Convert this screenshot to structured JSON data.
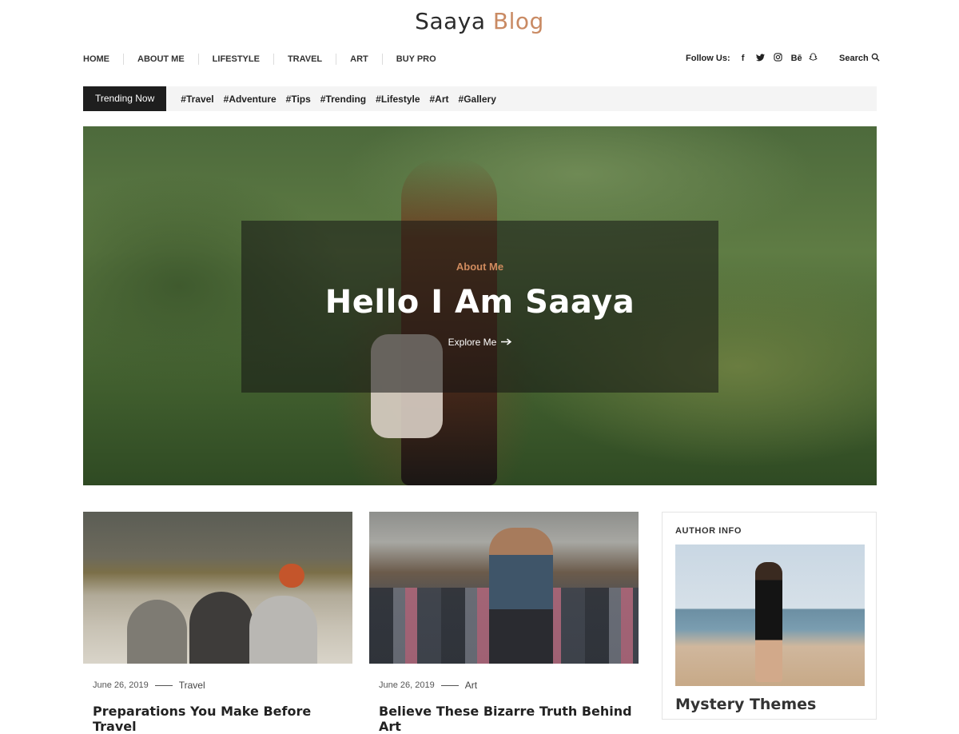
{
  "site": {
    "brand_part1": "Saaya",
    "brand_part2": "Blog",
    "accent_color": "#c98a63"
  },
  "nav": {
    "items": [
      "HOME",
      "ABOUT ME",
      "LIFESTYLE",
      "TRAVEL",
      "ART",
      "BUY PRO"
    ]
  },
  "follow": {
    "label": "Follow Us:",
    "icons": [
      {
        "name": "facebook-icon",
        "glyph": "f"
      },
      {
        "name": "twitter-icon",
        "glyph": "🐦"
      },
      {
        "name": "instagram-icon",
        "glyph": "◎"
      },
      {
        "name": "behance-icon",
        "glyph": "Bē"
      },
      {
        "name": "snapchat-icon",
        "glyph": "👻"
      }
    ]
  },
  "search": {
    "label": "Search",
    "icon": "search-icon"
  },
  "trending": {
    "label": "Trending Now",
    "tags": [
      "#Travel",
      "#Adventure",
      "#Tips",
      "#Trending",
      "#Lifestyle",
      "#Art",
      "#Gallery"
    ]
  },
  "hero": {
    "category": "About Me",
    "title": "Hello I Am Saaya",
    "cta": "Explore Me",
    "cta_icon": "arrow-right-icon"
  },
  "posts": [
    {
      "date": "June 26, 2019",
      "category": "Travel",
      "title": "Preparations You Make Before Travel"
    },
    {
      "date": "June 26, 2019",
      "category": "Art",
      "title": "Believe These Bizarre Truth Behind Art"
    }
  ],
  "sidebar": {
    "heading": "AUTHOR INFO",
    "name": "Mystery Themes"
  }
}
